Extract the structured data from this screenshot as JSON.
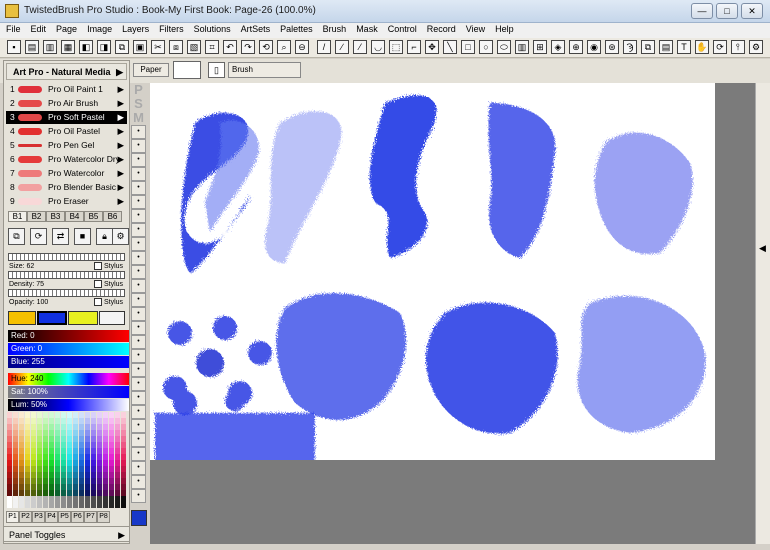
{
  "window": {
    "title": "TwistedBrush Pro Studio : Book-My First Book: Page-26 (100.0%)",
    "minimize": "—",
    "maximize": "□",
    "close": "✕"
  },
  "menu": [
    "File",
    "Edit",
    "Page",
    "Image",
    "Layers",
    "Filters",
    "Solutions",
    "ArtSets",
    "Palettes",
    "Brush",
    "Mask",
    "Control",
    "Record",
    "View",
    "Help"
  ],
  "propbar": {
    "paper_label": "Paper",
    "brush_label": "Brush"
  },
  "artset": {
    "title": "Art Pro - Natural Media",
    "brushes": [
      {
        "num": "1",
        "name": "Pro Oil Paint 1",
        "color": "#e0303a"
      },
      {
        "num": "2",
        "name": "Pro Air Brush",
        "color": "#e54a4a"
      },
      {
        "num": "3",
        "name": "Pro Soft Pastel",
        "color": "#e04848"
      },
      {
        "num": "4",
        "name": "Pro Oil Pastel",
        "color": "#e23030"
      },
      {
        "num": "5",
        "name": "Pro Pen Gel",
        "color": "#d83030"
      },
      {
        "num": "6",
        "name": "Pro Watercolor Dry",
        "color": "#e53a3a"
      },
      {
        "num": "7",
        "name": "Pro Watercolor",
        "color": "#ee7a7a"
      },
      {
        "num": "8",
        "name": "Pro Blender Basic",
        "color": "#f2a0a0"
      },
      {
        "num": "9",
        "name": "Pro Eraser",
        "color": "#f8d8d8"
      }
    ],
    "selected_index": 2,
    "tabs": [
      "B1",
      "B2",
      "B3",
      "B4",
      "B5",
      "B6"
    ]
  },
  "settings": {
    "size_label": "Size: 62",
    "density_label": "Density: 75",
    "opacity_label": "Opacity: 100",
    "stylus": "Stylus"
  },
  "color": {
    "red_label": "Red: 0",
    "green_label": "Green: 0",
    "blue_label": "Blue: 255",
    "hue_label": "Hue: 240",
    "sat_label": "Sat: 100%",
    "lum_label": "Lum: 50%",
    "swatches": [
      "#f5c000",
      "#1030e0",
      "#e8f020"
    ]
  },
  "palette_tabs": [
    "P1",
    "P2",
    "P3",
    "P4",
    "P5",
    "P6",
    "P7",
    "P8"
  ],
  "panel_toggles": "Panel Toggles",
  "psm": [
    "P",
    "S",
    "M"
  ]
}
